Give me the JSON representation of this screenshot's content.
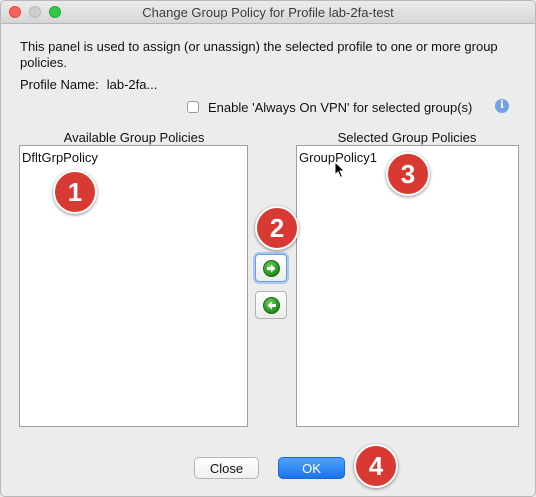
{
  "window": {
    "title": "Change Group Policy for Profile lab-2fa-test"
  },
  "panel": {
    "description": "This panel is used to assign (or unassign) the selected profile to one or more group policies.",
    "profile_label": "Profile Name:",
    "profile_value": "lab-2fa...",
    "always_on_vpn_label": "Enable 'Always On VPN' for selected group(s)",
    "always_on_vpn_checked": false,
    "info_icon": "i"
  },
  "available": {
    "header": "Available Group Policies",
    "items": [
      "DfltGrpPolicy"
    ]
  },
  "selected": {
    "header": "Selected Group Policies",
    "items": [
      "GroupPolicy1"
    ]
  },
  "buttons": {
    "close": "Close",
    "ok": "OK"
  },
  "badges": [
    "1",
    "2",
    "3",
    "4"
  ],
  "colors": {
    "badge_red": "#d83a33",
    "ok_blue": "#1b74ee",
    "arrow_green": "#1f8b1c"
  },
  "icons": {
    "add": "arrow-right-circle-icon",
    "remove": "arrow-left-circle-icon"
  }
}
